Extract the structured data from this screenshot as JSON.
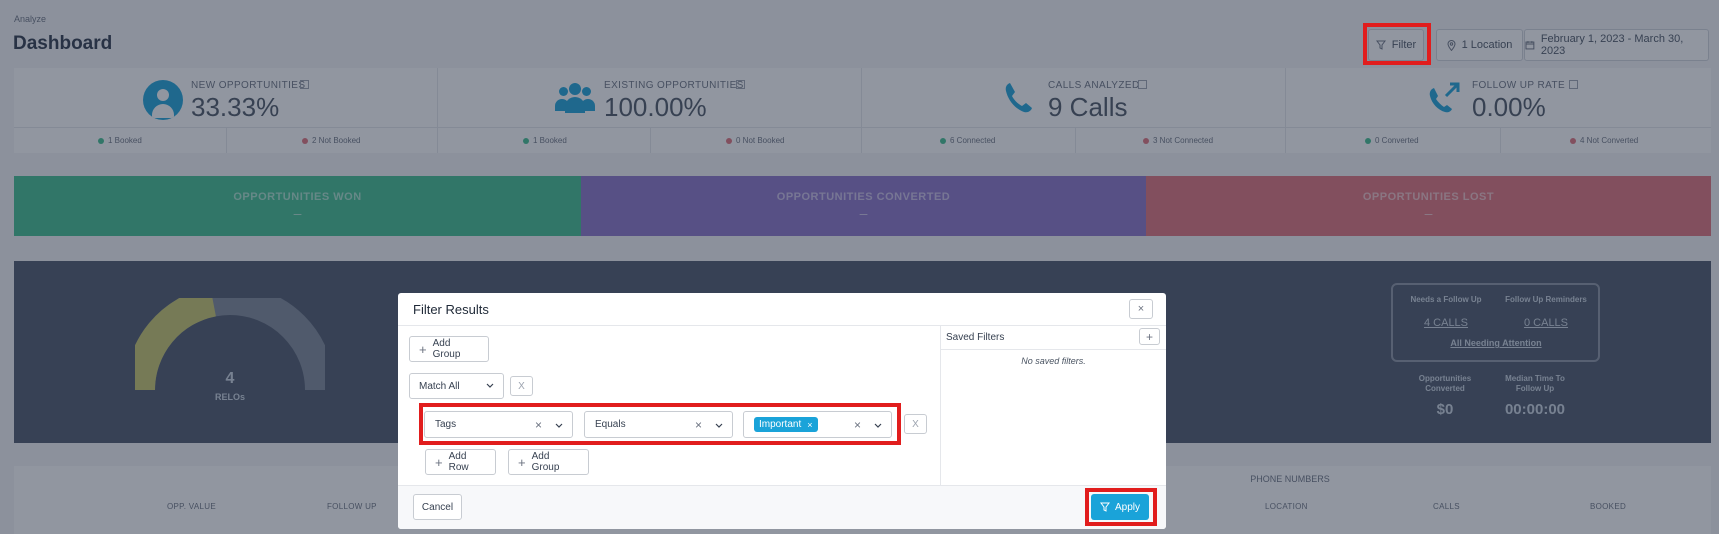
{
  "header": {
    "breadcrumb": "Analyze",
    "title": "Dashboard",
    "filter_label": "Filter",
    "location_label": "1 Location",
    "date_range": "February 1, 2023 - March 30, 2023"
  },
  "stats": [
    {
      "label": "NEW OPPORTUNITIES",
      "value": "33.33%",
      "sub_left": "1 Booked",
      "sub_right": "2 Not Booked",
      "icon": "person-icon"
    },
    {
      "label": "EXISTING OPPORTUNITIES",
      "value": "100.00%",
      "sub_left": "1 Booked",
      "sub_right": "0 Not Booked",
      "icon": "group-icon"
    },
    {
      "label": "CALLS ANALYZED",
      "value": "9 Calls",
      "sub_left": "6 Connected",
      "sub_right": "3 Not Connected",
      "icon": "phone-icon"
    },
    {
      "label": "FOLLOW UP RATE",
      "value": "0.00%",
      "sub_left": "0 Converted",
      "sub_right": "4 Not Converted",
      "icon": "phone-callback-icon"
    }
  ],
  "bands": [
    {
      "label": "OPPORTUNITIES WON",
      "value": "–"
    },
    {
      "label": "OPPORTUNITIES CONVERTED",
      "value": "–"
    },
    {
      "label": "OPPORTUNITIES LOST",
      "value": "–"
    }
  ],
  "gauge": {
    "value": "4",
    "label": "RELOs",
    "fill_fraction": 0.44
  },
  "followup": {
    "needs_label": "Needs a Follow Up",
    "needs_link": "4 CALLS",
    "reminders_label": "Follow Up Reminders",
    "reminders_link": "0 CALLS",
    "all_link": "All Needing Attention",
    "converted_label": "Opportunities Converted",
    "converted_value": "$0",
    "median_label": "Median Time To Follow Up",
    "median_value": "00:00:00"
  },
  "table": {
    "group_header": "PHONE NUMBERS",
    "columns": [
      "OPP. VALUE",
      "FOLLOW UP",
      "LOCATION",
      "CALLS",
      "BOOKED"
    ]
  },
  "modal": {
    "title": "Filter Results",
    "add_group": "Add Group",
    "match": "Match All",
    "row": {
      "field": "Tags",
      "operator": "Equals",
      "tag": "Important"
    },
    "add_row": "Add Row",
    "add_group_2": "Add Group",
    "saved_title": "Saved Filters",
    "saved_empty": "No saved filters.",
    "cancel": "Cancel",
    "apply": "Apply"
  },
  "colors": {
    "won": "#3fbf8f",
    "converted": "#8a72c9",
    "lost": "#e0707b",
    "accent": "#1aa3d9",
    "highlight": "#e11d1d"
  }
}
